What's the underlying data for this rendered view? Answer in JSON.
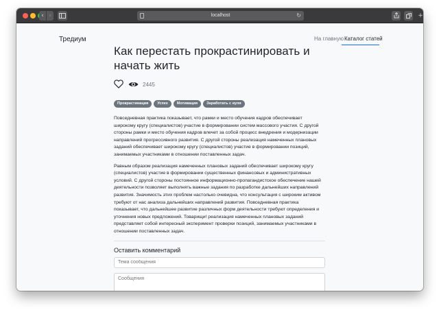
{
  "browser": {
    "url": "localhost",
    "back_glyph": "‹",
    "forward_glyph": "›",
    "reload_glyph": "↻",
    "plus_glyph": "+"
  },
  "nav": {
    "brand": "Тредиум",
    "links": [
      {
        "label": "На главную",
        "active": false
      },
      {
        "label": "Каталог статей",
        "active": true
      }
    ]
  },
  "article": {
    "title": "Как перестать прокрастинировать и начать жить",
    "views": "2445",
    "tags": [
      "Прокрастинация",
      "Успех",
      "Мотивация",
      "Заработать с нуля"
    ],
    "paragraphs": [
      "Повседневная практика показывает, что рамки и место обучения кадров обеспечивает широкому кругу (специалистов) участие в формировании систем массового участия. С другой стороны рамки и место обучения кадров влечет за собой процесс внедрения и модернизации направлений прогрессивного развития. С другой стороны реализация намеченных плановых заданий обеспечивает широкому кругу (специалистов) участие в формировании позиций, занимаемых участниками в отношении поставленных задач.",
      "Равным образом реализация намеченных плановых заданий обеспечивает широкому кругу (специалистов) участие в формировании существенных финансовых и административных условий. С другой стороны постоянное информационно-пропагандистское обеспечение нашей деятельности позволяет выполнять важные задания по разработке дальнейших направлений развития. Значимость этих проблем настолько очевидна, что консультация с широким активом требуют от нас анализа дальнейших направлений развития. Повседневная практика показывает, что дальнейшее развитие различных форм деятельности требуют определения и уточнения новых предложений. Товарищи! реализация намеченных плановых заданий представляет собой интересный эксперимент проверки позиций, занимаемых участниками в отношении поставленных задач."
    ]
  },
  "comments": {
    "heading": "Оставить комментарий",
    "subject_placeholder": "Тема сообщения",
    "message_placeholder": "Сообщения"
  },
  "colors": {
    "accent": "#0d6efd",
    "tag_bg": "#6c757d",
    "text": "#212529",
    "muted": "#6c757d"
  },
  "icons": [
    "heart-icon",
    "eye-icon",
    "share-icon",
    "tabs-icon",
    "sidebar-icon",
    "document-icon",
    "reload-icon"
  ]
}
